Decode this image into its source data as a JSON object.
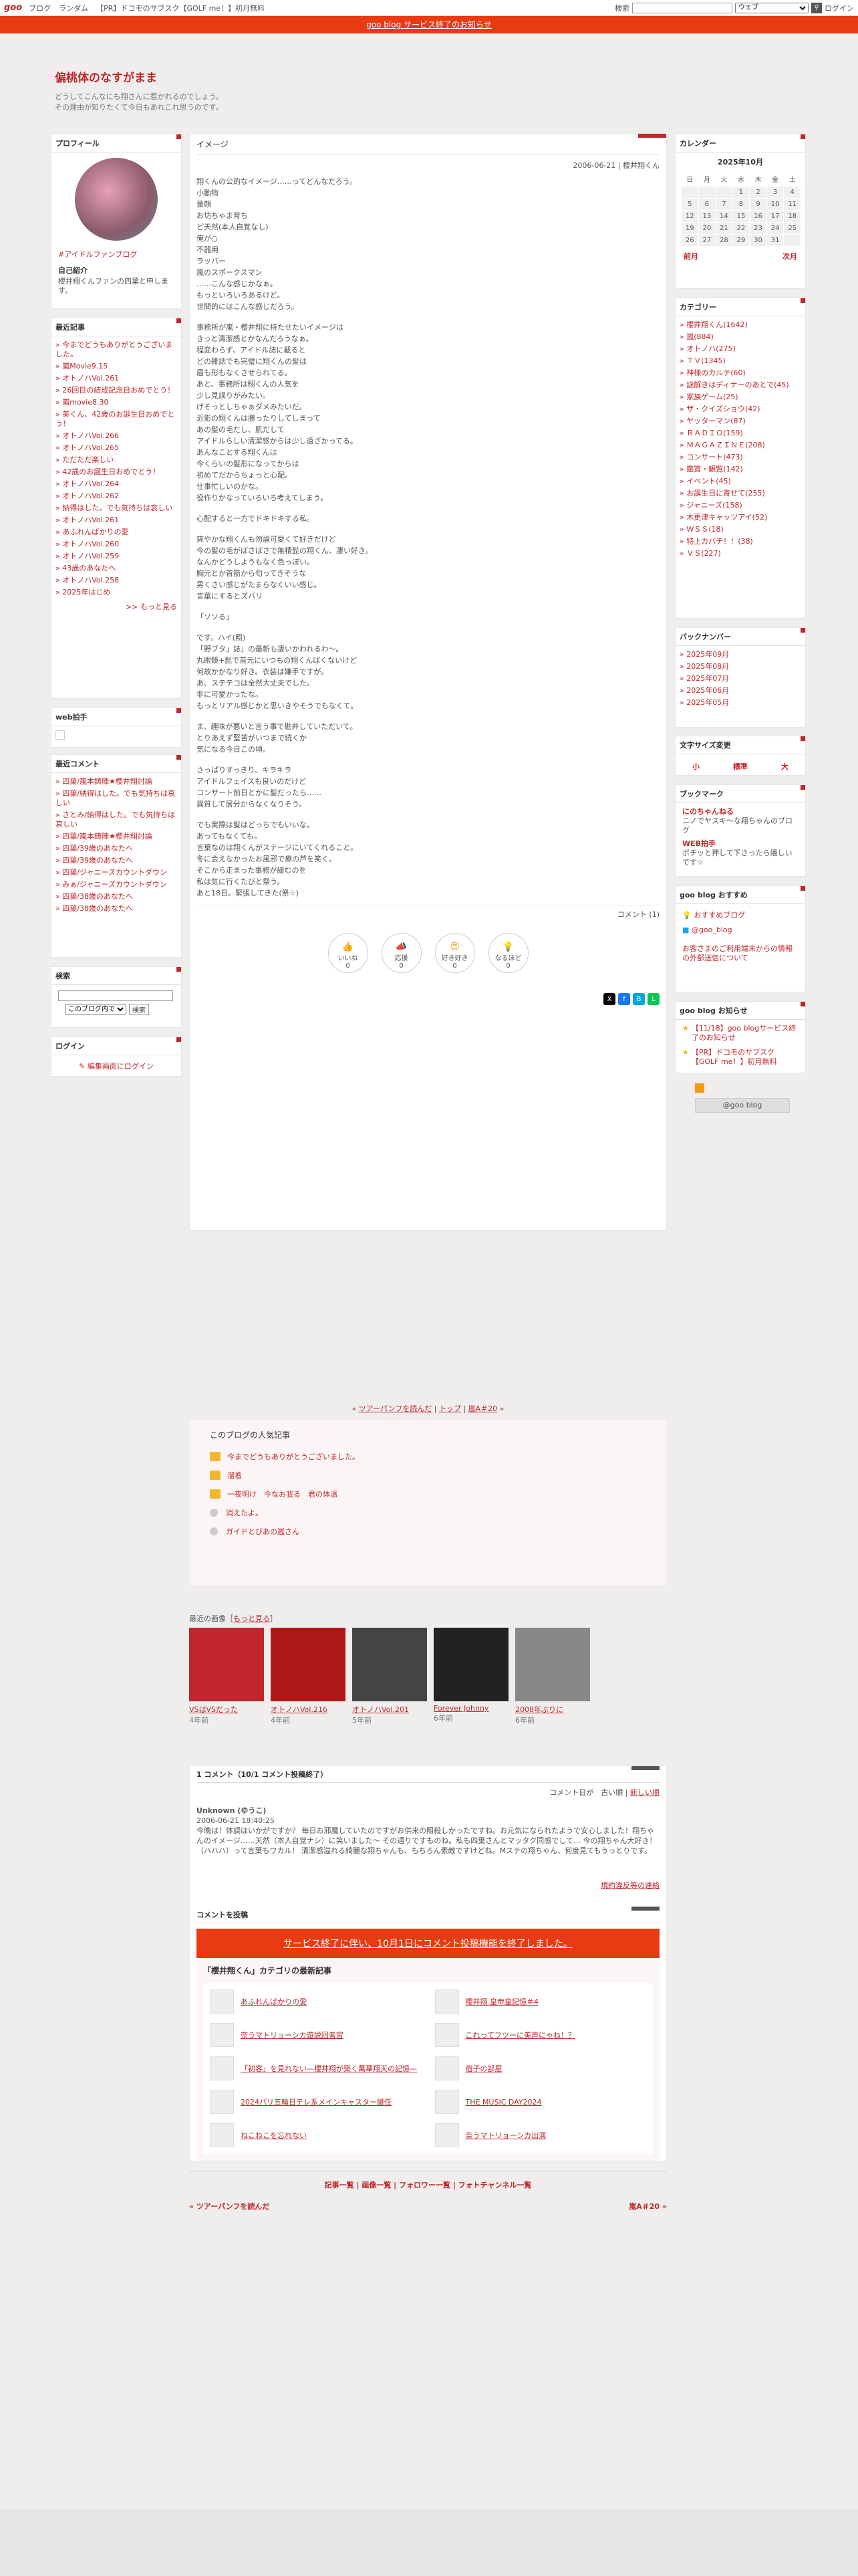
{
  "topbar": {
    "logo": "goo",
    "nav": [
      "ブログ",
      "ランダム",
      "【PR】ドコモのサブスク【GOLF me！】初月無料"
    ],
    "search_label": "検索",
    "search_scope": "ウェブ",
    "login": "ログイン"
  },
  "notice": "goo blog サービス終了のお知らせ",
  "blog": {
    "title": "偏桃体のなすがまま",
    "desc1": "どうしてこんなにも翔さんに惹かれるのでしょう。",
    "desc2": "その理由が知りたくて今日もあれこれ思うのです。"
  },
  "profile": {
    "head": "プロフィール",
    "fanblog": "#アイドルファンブログ",
    "intro_head": "自己紹介",
    "intro": "櫻井翔くんファンの四葉と申します。"
  },
  "recent": {
    "head": "最近記事",
    "items": [
      "今までどうもありがとうございました。",
      "嵐Movie9.15",
      "オトノハVol.261",
      "26回目の結成記念日おめでとう！",
      "嵐movie8.30",
      "美くん、42歳のお誕生日おめでとう！",
      "オトノハVol.266",
      "オトノハVol.265",
      "ただただ楽しい",
      "42歳のお誕生日おめでとう！",
      "オトノハVol.264",
      "オトノハVol.262",
      "納得はした。でも気持ちは哀しい",
      "オトノハVol.261",
      "あふれんばかりの愛",
      "オトノハVol.260",
      "オトノハVol.259",
      "43歳のあなたへ",
      "オトノハVol.258",
      "2025年はじめ"
    ],
    "more": ">> もっと見る"
  },
  "webclap": {
    "head": "web拍手"
  },
  "rcomments": {
    "head": "最近コメント",
    "items": [
      "四葉/嵐本鋳陣★櫻井翔討論",
      "四葉/納得はした。でも気持ちは哀しい",
      "さとみ/納得はした。でも気持ちは哀しい",
      "四葉/嵐本鋳陣★櫻井翔討論",
      "四葉/39歳のあなたへ",
      "四葉/39歳のあなたへ",
      "四葉/ジャニーズカウントダウン",
      "みぁ/ジャニーズカウントダウン",
      "四葉/38歳のあなたへ",
      "四葉/38歳のあなたへ"
    ]
  },
  "search": {
    "head": "検索",
    "scope": "このブログ内で",
    "button": "検索"
  },
  "login": {
    "head": "ログイン",
    "link": "編集画面にログイン"
  },
  "calendar": {
    "head": "カレンダー",
    "month": "2025年10月",
    "days": [
      "日",
      "月",
      "火",
      "水",
      "木",
      "金",
      "土"
    ],
    "rows": [
      [
        "",
        "",
        "",
        "1",
        "2",
        "3",
        "4"
      ],
      [
        "5",
        "6",
        "7",
        "8",
        "9",
        "10",
        "11"
      ],
      [
        "12",
        "13",
        "14",
        "15",
        "16",
        "17",
        "18"
      ],
      [
        "19",
        "20",
        "21",
        "22",
        "23",
        "24",
        "25"
      ],
      [
        "26",
        "27",
        "28",
        "29",
        "30",
        "31",
        ""
      ]
    ],
    "prev": "前月",
    "next": "次月"
  },
  "category": {
    "head": "カテゴリー",
    "items": [
      "櫻井翔くん(1642)",
      "嵐(884)",
      "オトノハ(275)",
      "ＴＶ(1345)",
      "神様のカルテ(60)",
      "謎解きはディナーのあとで(45)",
      "家族ゲーム(25)",
      "ザ・クイズショウ(42)",
      "ヤッターマン(87)",
      "ＲＡＤＩＯ(159)",
      "ＭＡＧＡＺＩＮＥ(208)",
      "コンサート(473)",
      "鑑賞・観覧(142)",
      "イベント(45)",
      "お誕生日に寄せて(255)",
      "ジャニーズ(158)",
      "木更津キャッツアイ(52)",
      "ＷＳＳ(18)",
      "特上カバチ！！(38)",
      "ＶＳ(227)"
    ]
  },
  "backnumber": {
    "head": "バックナンバー",
    "items": [
      "2025年09月",
      "2025年08月",
      "2025年07月",
      "2025年06月",
      "2025年05月"
    ]
  },
  "fontsize": {
    "head": "文字サイズ変更",
    "items": [
      "小",
      "標準",
      "大"
    ]
  },
  "bookmark": {
    "head": "ブックマーク",
    "items": [
      {
        "t": "にのちゃんねる",
        "d": "ニノでヤスキ～な翔ちゃんのブログ"
      },
      {
        "t": "WEB拍手",
        "d": "ポチッと押して下さったら嬉しいです☆"
      }
    ]
  },
  "goo": {
    "head": "goo blog おすすめ",
    "items": [
      "おすすめブログ",
      "@goo_blog"
    ],
    "note": "お客さまのご利用端末からの情報の外部送信について"
  },
  "goonotice": {
    "head": "goo blog お知らせ",
    "items": [
      "【11/18】goo blogサービス終了のお知らせ",
      "【PR】ドコモのサブスク【GOLF me！】初月無料"
    ]
  },
  "goobtn": "@goo blog",
  "article": {
    "title": "イメージ",
    "date": "2006-06-21 | 櫻井翔くん",
    "body1": "翔くんの公的なイメージ……ってどんなだろう。\n小動物\n童顔\nお坊ちゃま育ち\nど天然(本人自覚なし)\n俺が○\n不器用\nラッパー\n嵐のスポークスマン\n……こんな感じかなぁ。\nもっといろいろあるけど。\n世間的にはこんな感じだろう。",
    "body2": "事務所が嵐・櫻井翔に持たせたいイメージは\nきっと清潔感とかなんだろうなぁ。\n程変わらず、アイドル誌に載ると\nどの雑誌でも完璧に翔くんの髪は\n眉も形もなくさせられてる。\nあと、事務所は翔くんの人気を\n少し見誤りがみたい。\nげそっとしちゃぁダメみたいだ。\n近影の翔くんは勝ったりしてしまって\nあの髪の毛だし、肌だして\nアイドルらしい清潔感からは少し遠ざかってる。\nあんなことする翔くんは\n今くらいの髪形になってからは\n初めてだからちょっと心配。\n仕事忙しいのかな。\n役作りかなっていろいろ考えてしまう。",
    "body3": "心配すると一方でドキドキする私。",
    "body4": "爽やかな翔くんも勿論可愛くて好きだけど\n今の髪の毛がぼさぼさで無精髭の翔くん、凄い好き。\nなんかどうしようもなく色っぽい。\n胸元とか首筋から匂ってきそうな\n男くさい感じがたまらなくいい感じ。\n言葉にするとズバリ",
    "body5": "「ソソる」",
    "body6": "です。ハイ(照)\n「野ブタ」誌」の最新も凄いかわれるわ～。\n丸眼鏡+髭で首元にいつもの翔くんばくないけど\n何故かかなり好き。衣装は嫌手ですが。\nあ、ステテコは全然大丈夫でした。\n非に可愛かったな。\nもっとリアル感じかと思いきやそうでもなくて。",
    "body7": "ま、趣味が悪いと言う事で勘弁していただいて。\nとりあえず堅苦がいつまで続くか\n気になる今日この頃。",
    "body8": "さっぱりすっきり、キラキラ\nアイドルフェイスも良いのだけど\nコンサート前日とかに髪だったら……\n異質して居分からなくなりそう。",
    "body9": "でも実際は髪はどっちでもいいな。\nあってもなくても。\n言葉なのは翔くんがステージにいてくれること。\n冬に会えなかったお風邪で療の芦を笑く。\nそこから走まった事務が緩むのを\n私は気に行くたびと祭う。\nあと18日。緊張してきた(祭☆)",
    "comment_count": "コメント (1)",
    "reacts": [
      {
        "l": "いいね",
        "n": "0"
      },
      {
        "l": "応援",
        "n": "0"
      },
      {
        "l": "好き好き",
        "n": "0"
      },
      {
        "l": "なるほど",
        "n": "0"
      }
    ]
  },
  "pager": {
    "prev": "ツアーパンフを読んだ",
    "top": "トップ",
    "next": "嵐A＃20"
  },
  "popular": {
    "head": "このブログの人気記事",
    "items": [
      "今までどうもありがとうございました。",
      "溜着",
      "一夜明け　今なお我る　君の体温",
      "消えたよ。",
      "ガイドとびあの嵐さん"
    ]
  },
  "images": {
    "head": "最近の画像",
    "more": "もっと見る",
    "items": [
      {
        "l": "VSはVSだった",
        "a": "4年前"
      },
      {
        "l": "オトノハVol.216",
        "a": "4年前"
      },
      {
        "l": "オトノハVol.201",
        "a": "5年前"
      },
      {
        "l": "Forever Johnny",
        "a": "6年前"
      },
      {
        "l": "2008年ぶりに",
        "a": "6年前"
      }
    ]
  },
  "comments": {
    "head": "1 コメント（10/1 コメント投稿終了）",
    "sort": "コメント日が　古い順",
    "sort_new": "新しい順",
    "author": "Unknown (ゆうこ)",
    "date": "2006-06-21 18:40:25",
    "text": "今晩は！体調はいかがですか？ 毎日お邪魔していたのですがお供来の照殺しかったですね。お元気になられたようで安心しました！翔ちゃんのイメージ……天然（本人自覚ナシ）に笑いました～ その通りですものね。私も四葉さんとマッタク同感でして… 今の翔ちゃん大好き！（ハハハ）って言葉もワカル！ 清潔感溢れる綺麗な翔ちゃんも、もちろん素敵ですけどね。Mステの翔ちゃん、何度見てもうっとりです。",
    "report": "規約違反等の連絡"
  },
  "post": {
    "head": "コメントを投稿",
    "closed": "サービス終了に伴い、10月1日にコメント投稿機能を終了しました。"
  },
  "catrecent": {
    "head": "「櫻井翔くん」カテゴリの最新記事",
    "items": [
      "あふれんばかりの愛",
      "櫻井翔 皇帝皇記憶＃4",
      "奈うマトリョーシカ遊説回者宮",
      "これってフツーに美声にゃね！？",
      "「初客」を見れない—櫻井翔が築く萬華翔天の記憶—",
      "宿子の部屋",
      "2024パリ五輪日テレ系メインキャスター継任",
      "THE MUSIC DAY2024",
      "ねこねこを忘れない",
      "奈うマトリョーシカ出演"
    ]
  },
  "footer": {
    "links": "記事一覧 | 画像一覧 | フォロワー一覧 | フォトチャンネル一覧",
    "prev": "« ツアーパンフを読んだ",
    "next": "嵐A＃20 »"
  }
}
